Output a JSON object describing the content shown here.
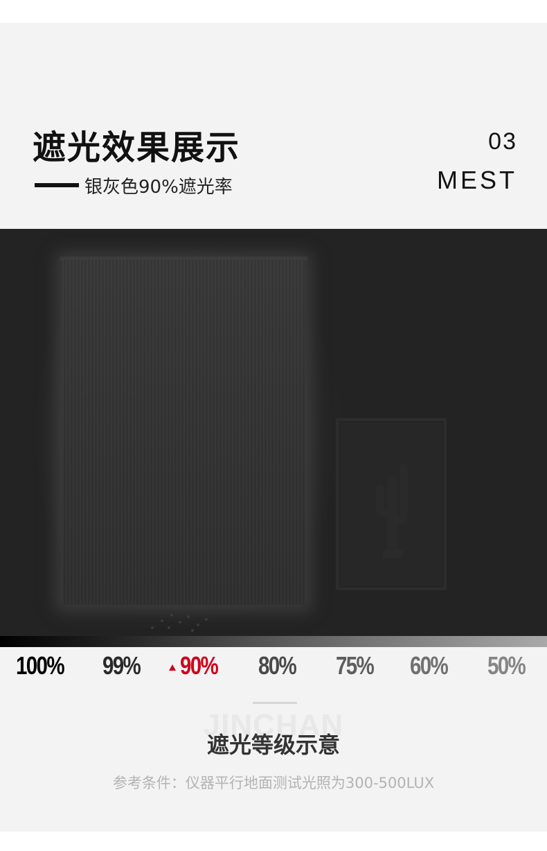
{
  "header": {
    "title": "遮光效果展示",
    "subtitle": "银灰色90%遮光率",
    "section_number": "03",
    "section_word": "MEST"
  },
  "scale": {
    "levels": [
      {
        "label": "100%",
        "color": "#000000"
      },
      {
        "label": "99%",
        "color": "#2a2a2a"
      },
      {
        "label": "90%",
        "color": "#d0021b",
        "selected": true
      },
      {
        "label": "80%",
        "color": "#4a4a4a"
      },
      {
        "label": "75%",
        "color": "#5e5e5e"
      },
      {
        "label": "60%",
        "color": "#707070"
      },
      {
        "label": "50%",
        "color": "#858585"
      }
    ],
    "selected_marker_icon": "triangle-up-icon"
  },
  "footer": {
    "watermark": "JINCHAN",
    "title": "遮光等级示意",
    "note": "参考条件：仪器平行地面测试光照为300-500LUX"
  },
  "colors": {
    "accent": "#d0021b",
    "page_background": "#f3f3f3",
    "photo_background": "#232323"
  }
}
